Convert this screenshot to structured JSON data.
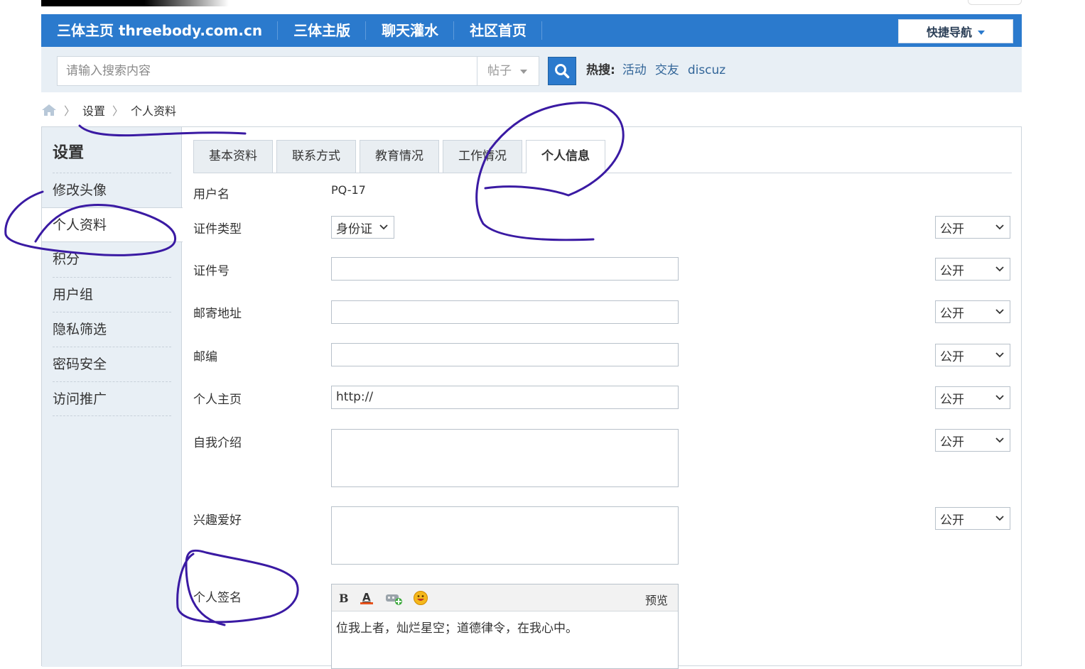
{
  "nav": {
    "items": [
      "三体主页 threebody.com.cn",
      "三体主版",
      "聊天灌水",
      "社区首页"
    ],
    "quick_nav": "快捷导航"
  },
  "search": {
    "placeholder": "请输入搜索内容",
    "type": "帖子",
    "hot_label": "热搜:",
    "hot_items": [
      "活动",
      "交友",
      "discuz"
    ]
  },
  "breadcrumb": {
    "items": [
      "设置",
      "个人资料"
    ]
  },
  "sidebar": {
    "title": "设置",
    "items": [
      "修改头像",
      "个人资料",
      "积分",
      "用户组",
      "隐私筛选",
      "密码安全",
      "访问推广"
    ],
    "active_index": 1
  },
  "tabs": {
    "items": [
      "基本资料",
      "联系方式",
      "教育情况",
      "工作情况",
      "个人信息"
    ],
    "active_index": 4
  },
  "form": {
    "username_label": "用户名",
    "username_value": "PQ-17",
    "id_type_label": "证件类型",
    "id_type_value": "身份证",
    "id_number_label": "证件号",
    "address_label": "邮寄地址",
    "postcode_label": "邮编",
    "homepage_label": "个人主页",
    "homepage_value": "http://",
    "bio_label": "自我介绍",
    "hobby_label": "兴趣爱好",
    "signature_label": "个人签名",
    "public_option": "公开",
    "preview_label": "预览",
    "signature_text": "位我上者，灿烂星空；道德律令，在我心中。"
  },
  "colors": {
    "nav_bg": "#2b7acd",
    "search_bg": "#e8eff5",
    "annotation": "#3a1aa3"
  }
}
